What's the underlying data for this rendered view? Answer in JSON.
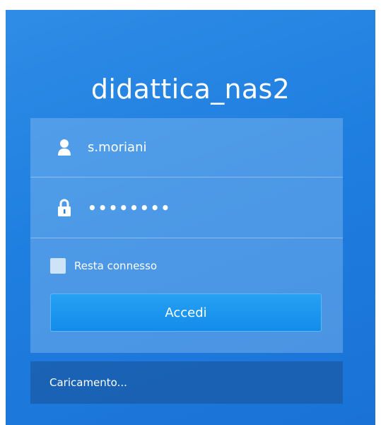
{
  "server": {
    "name": "didattica_nas2"
  },
  "login": {
    "username_value": "s.moriani",
    "password_masked": "••••••••",
    "remember_label": "Resta connesso",
    "remember_checked": false,
    "submit_label": "Accedi"
  },
  "status": {
    "text": "Caricamento..."
  },
  "icons": {
    "username": "user-icon",
    "password": "lock-icon"
  },
  "colors": {
    "accent": "#1f7fe0",
    "button": "#1a95ee"
  }
}
